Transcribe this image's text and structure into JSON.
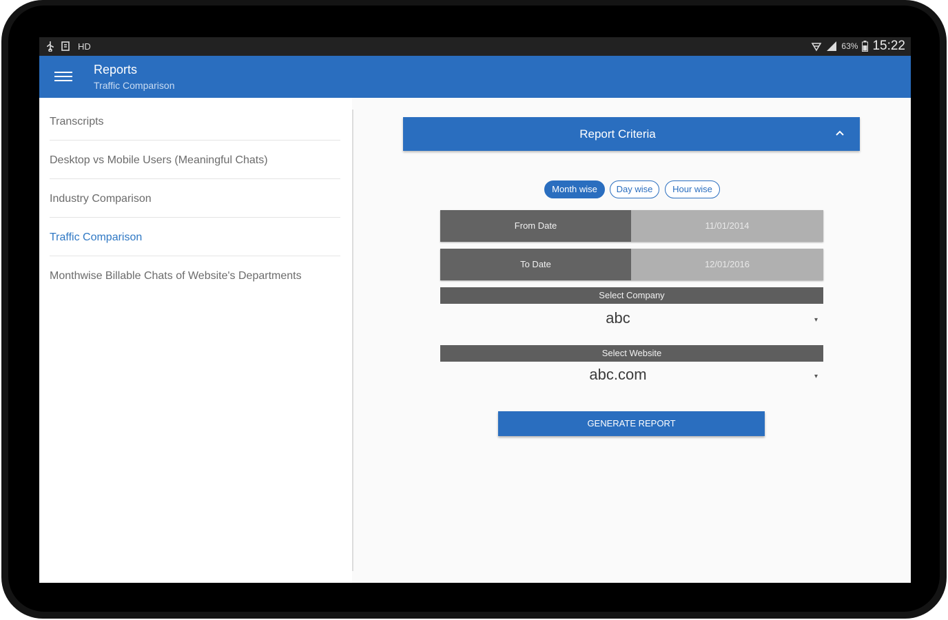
{
  "status_bar": {
    "left_icons": [
      "usb-icon",
      "download-icon",
      "hd-icon"
    ],
    "hd_label": "HD",
    "battery_pct": "63%",
    "time": "15:22"
  },
  "app_bar": {
    "title": "Reports",
    "subtitle": "Traffic Comparison"
  },
  "sidebar": {
    "items": [
      {
        "label": "Transcripts",
        "active": false
      },
      {
        "label": "Desktop vs Mobile Users (Meaningful Chats)",
        "active": false
      },
      {
        "label": "Industry Comparison",
        "active": false
      },
      {
        "label": "Traffic Comparison",
        "active": true
      },
      {
        "label": "Monthwise Billable Chats of Website's Departments",
        "active": false
      }
    ]
  },
  "criteria": {
    "header_label": "Report Criteria",
    "toggle_icon": "chevron-up-icon",
    "segments": [
      {
        "label": "Month wise",
        "selected": true
      },
      {
        "label": "Day wise",
        "selected": false
      },
      {
        "label": "Hour wise",
        "selected": false
      }
    ],
    "from_date": {
      "label": "From Date",
      "value": "11/01/2014"
    },
    "to_date": {
      "label": "To Date",
      "value": "12/01/2016"
    },
    "company": {
      "label": "Select Company",
      "value": "abc"
    },
    "website": {
      "label": "Select Website",
      "value": "abc.com"
    },
    "generate_label": "GENERATE REPORT"
  },
  "colors": {
    "primary": "#2a6ebf",
    "active_link": "#2f78c4",
    "dark_cell": "#636363",
    "light_cell": "#b0b0b0"
  }
}
